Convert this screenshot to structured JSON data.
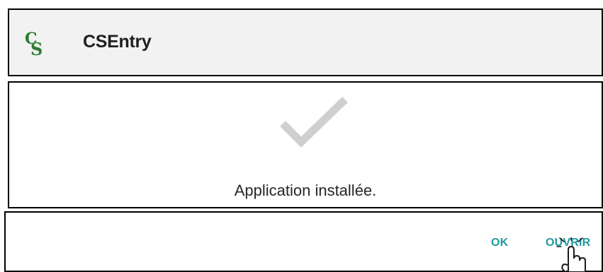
{
  "app": {
    "title": "CSEntry",
    "icon": "csentry-logo-icon"
  },
  "dialog": {
    "status_icon": "checkmark-icon",
    "message": "Application installée."
  },
  "actions": {
    "ok_label": "OK",
    "open_label": "OUVRIR"
  },
  "cursor": {
    "icon": "hand-pointer-cursor-icon"
  },
  "colors": {
    "accent": "#1e9aa0",
    "logo_green": "#2e7d32",
    "checkmark": "#cfcfcf",
    "header_bg": "#f2f2f2"
  }
}
